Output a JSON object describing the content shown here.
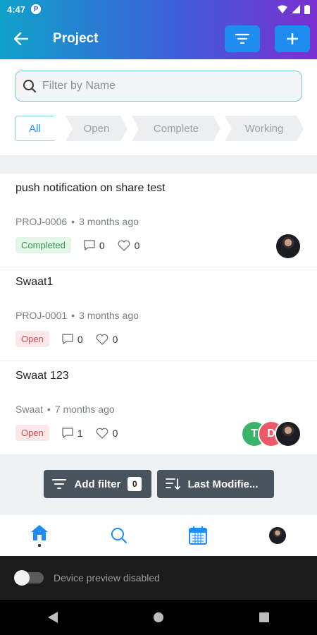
{
  "status_bar": {
    "time": "4:47",
    "app_badge": "P"
  },
  "header": {
    "title": "Project"
  },
  "search": {
    "placeholder": "Filter by Name"
  },
  "tabs": [
    {
      "label": "All",
      "active": true
    },
    {
      "label": "Open",
      "active": false
    },
    {
      "label": "Complete",
      "active": false
    },
    {
      "label": "Working",
      "active": false
    }
  ],
  "projects": [
    {
      "title": "push notification on share test",
      "code": "PROJ-0006",
      "updated": "3 months ago",
      "status": "Completed",
      "comments": "0",
      "likes": "0"
    },
    {
      "title": "Swaat1",
      "code": "PROJ-0001",
      "updated": "3 months ago",
      "status": "Open",
      "comments": "0",
      "likes": "0"
    },
    {
      "title": "Swaat 123",
      "code": "Swaat",
      "updated": "7 months ago",
      "status": "Open",
      "comments": "1",
      "likes": "0",
      "members": [
        "T",
        "D"
      ]
    }
  ],
  "actions": {
    "add_filter_label": "Add filter",
    "filter_count": "0",
    "sort_label": "Last Modifie..."
  },
  "preview": {
    "label": "Device preview disabled"
  },
  "colors": {
    "accent": "#1e8cf0",
    "completed": "#2e9a4a",
    "open": "#e0454a",
    "member_t": "#3bb36b",
    "member_d": "#ec5a6a"
  }
}
